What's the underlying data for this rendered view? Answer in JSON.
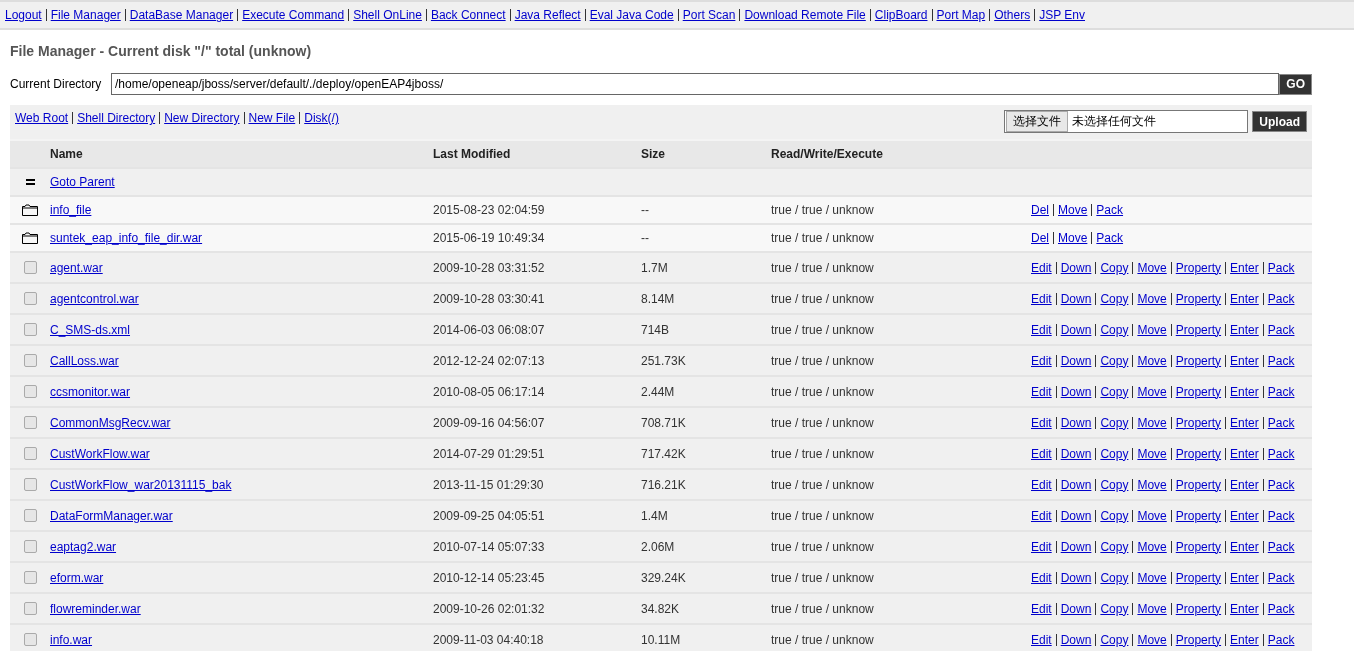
{
  "nav": [
    "Logout",
    "File Manager",
    "DataBase Manager",
    "Execute Command",
    "Shell OnLine",
    "Back Connect",
    "Java Reflect",
    "Eval Java Code",
    "Port Scan",
    "Download Remote File",
    "ClipBoard",
    "Port Map",
    "Others",
    "JSP Env"
  ],
  "title": "File Manager - Current disk \"/\" total (unknow)",
  "directory": {
    "label": "Current Directory",
    "value": "/home/openeap/jboss/server/default/./deploy/openEAP4jboss/",
    "button": "GO"
  },
  "toolbar_links": [
    "Web Root",
    "Shell Directory",
    "New Directory",
    "New File",
    "Disk(/)"
  ],
  "upload": {
    "choose_button": "选择文件",
    "file_status": "未选择任何文件",
    "button": "Upload"
  },
  "table": {
    "columns": [
      "Name",
      "Last Modified",
      "Size",
      "Read/Write/Execute"
    ],
    "rows": [
      {
        "kind": "parent",
        "name": "Goto Parent"
      },
      {
        "kind": "dir",
        "name": "info_file",
        "modified": "2015-08-23 02:04:59",
        "size": "--",
        "rwe": "true / true / unknow",
        "actions": [
          "Del",
          "Move",
          "Pack"
        ]
      },
      {
        "kind": "dir",
        "name": "suntek_eap_info_file_dir.war",
        "modified": "2015-06-19 10:49:34",
        "size": "--",
        "rwe": "true / true / unknow",
        "actions": [
          "Del",
          "Move",
          "Pack"
        ]
      },
      {
        "kind": "file",
        "checked": false,
        "name": "agent.war",
        "modified": "2009-10-28 03:31:52",
        "size": "1.7M",
        "rwe": "true / true / unknow",
        "actions": [
          "Edit",
          "Down",
          "Copy",
          "Move",
          "Property",
          "Enter",
          "Pack"
        ]
      },
      {
        "kind": "file",
        "checked": false,
        "name": "agentcontrol.war",
        "modified": "2009-10-28 03:30:41",
        "size": "8.14M",
        "rwe": "true / true / unknow",
        "actions": [
          "Edit",
          "Down",
          "Copy",
          "Move",
          "Property",
          "Enter",
          "Pack"
        ]
      },
      {
        "kind": "file",
        "checked": false,
        "name": "C_SMS-ds.xml",
        "modified": "2014-06-03 06:08:07",
        "size": "714B",
        "rwe": "true / true / unknow",
        "actions": [
          "Edit",
          "Down",
          "Copy",
          "Move",
          "Property",
          "Enter",
          "Pack"
        ]
      },
      {
        "kind": "file",
        "checked": false,
        "name": "CallLoss.war",
        "modified": "2012-12-24 02:07:13",
        "size": "251.73K",
        "rwe": "true / true / unknow",
        "actions": [
          "Edit",
          "Down",
          "Copy",
          "Move",
          "Property",
          "Enter",
          "Pack"
        ]
      },
      {
        "kind": "file",
        "checked": false,
        "name": "ccsmonitor.war",
        "modified": "2010-08-05 06:17:14",
        "size": "2.44M",
        "rwe": "true / true / unknow",
        "actions": [
          "Edit",
          "Down",
          "Copy",
          "Move",
          "Property",
          "Enter",
          "Pack"
        ]
      },
      {
        "kind": "file",
        "checked": false,
        "name": "CommonMsgRecv.war",
        "modified": "2009-09-16 04:56:07",
        "size": "708.71K",
        "rwe": "true / true / unknow",
        "actions": [
          "Edit",
          "Down",
          "Copy",
          "Move",
          "Property",
          "Enter",
          "Pack"
        ]
      },
      {
        "kind": "file",
        "checked": false,
        "name": "CustWorkFlow.war",
        "modified": "2014-07-29 01:29:51",
        "size": "717.42K",
        "rwe": "true / true / unknow",
        "actions": [
          "Edit",
          "Down",
          "Copy",
          "Move",
          "Property",
          "Enter",
          "Pack"
        ]
      },
      {
        "kind": "file",
        "checked": false,
        "name": "CustWorkFlow_war20131115_bak",
        "modified": "2013-11-15 01:29:30",
        "size": "716.21K",
        "rwe": "true / true / unknow",
        "actions": [
          "Edit",
          "Down",
          "Copy",
          "Move",
          "Property",
          "Enter",
          "Pack"
        ]
      },
      {
        "kind": "file",
        "checked": false,
        "name": "DataFormManager.war",
        "modified": "2009-09-25 04:05:51",
        "size": "1.4M",
        "rwe": "true / true / unknow",
        "actions": [
          "Edit",
          "Down",
          "Copy",
          "Move",
          "Property",
          "Enter",
          "Pack"
        ]
      },
      {
        "kind": "file",
        "checked": false,
        "name": "eaptag2.war",
        "modified": "2010-07-14 05:07:33",
        "size": "2.06M",
        "rwe": "true / true / unknow",
        "actions": [
          "Edit",
          "Down",
          "Copy",
          "Move",
          "Property",
          "Enter",
          "Pack"
        ]
      },
      {
        "kind": "file",
        "checked": false,
        "name": "eform.war",
        "modified": "2010-12-14 05:23:45",
        "size": "329.24K",
        "rwe": "true / true / unknow",
        "actions": [
          "Edit",
          "Down",
          "Copy",
          "Move",
          "Property",
          "Enter",
          "Pack"
        ]
      },
      {
        "kind": "file",
        "checked": false,
        "name": "flowreminder.war",
        "modified": "2009-10-26 02:01:32",
        "size": "34.82K",
        "rwe": "true / true / unknow",
        "actions": [
          "Edit",
          "Down",
          "Copy",
          "Move",
          "Property",
          "Enter",
          "Pack"
        ]
      },
      {
        "kind": "file",
        "checked": false,
        "name": "info.war",
        "modified": "2009-11-03 04:40:18",
        "size": "10.11M",
        "rwe": "true / true / unknow",
        "actions": [
          "Edit",
          "Down",
          "Copy",
          "Move",
          "Property",
          "Enter",
          "Pack"
        ]
      }
    ]
  }
}
